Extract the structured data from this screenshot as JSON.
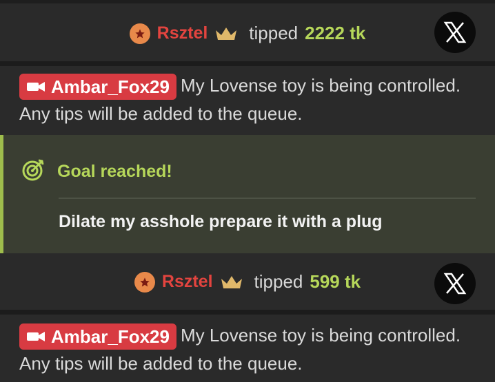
{
  "tips": [
    {
      "username": "Rsztel",
      "tipped_label": "tipped",
      "amount": "2222 tk"
    },
    {
      "username": "Rsztel",
      "tipped_label": "tipped",
      "amount": "599 tk"
    }
  ],
  "messages": [
    {
      "username": "Ambar_Fox29",
      "text": "My Lovense toy is being controlled. Any tips will be added to the queue."
    },
    {
      "username": "Ambar_Fox29",
      "text": "My Lovense toy is being controlled. Any tips will be added to the queue."
    }
  ],
  "goal": {
    "title": "Goal reached!",
    "text": "Dilate my asshole prepare it with a plug"
  },
  "colors": {
    "username_red": "#e3443f",
    "tag_red": "#d83b42",
    "green": "#b6d75a",
    "badge_orange": "#e8894a",
    "crown_gold": "#e0b86a"
  },
  "icons": {
    "badge": "star-badge-icon",
    "crown": "crown-icon",
    "close": "x-logo-icon",
    "camera": "video-camera-icon",
    "goal": "target-icon"
  }
}
